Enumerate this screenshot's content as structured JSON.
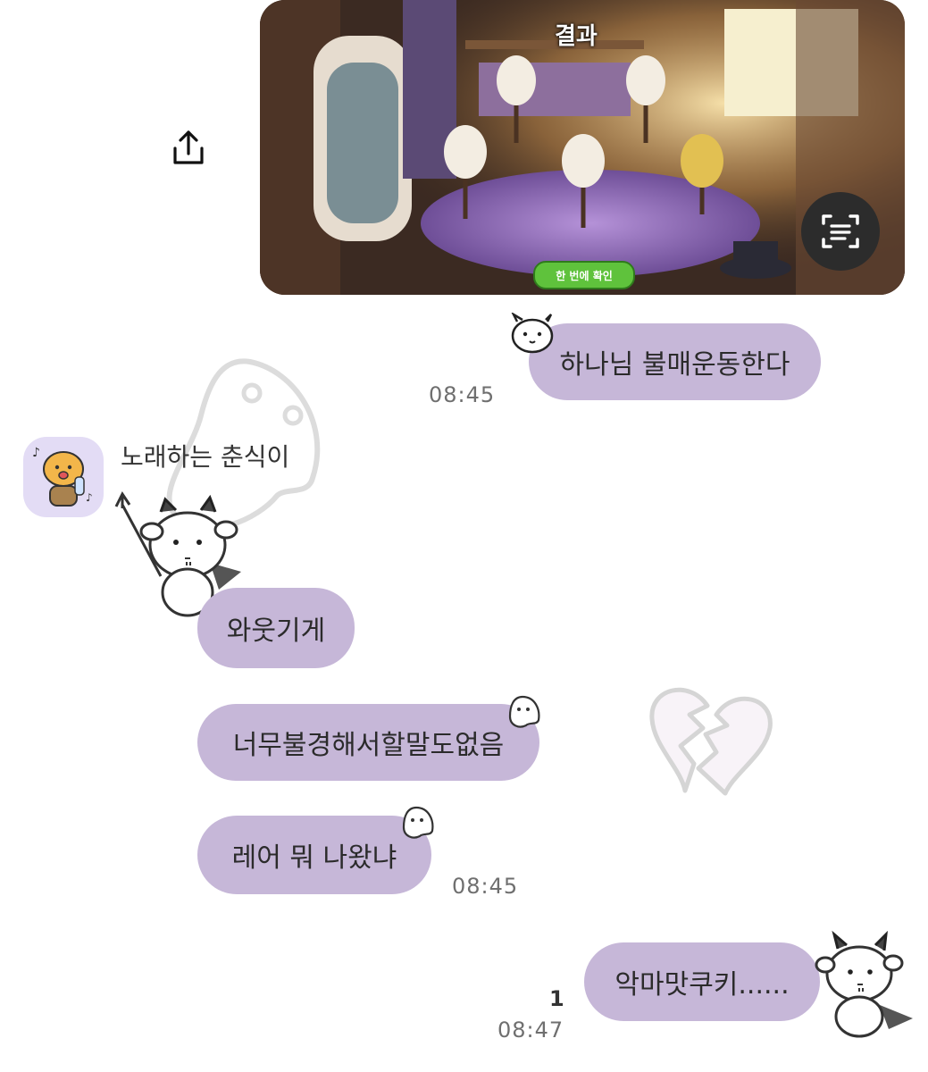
{
  "shared_image": {
    "title": "결과",
    "button_label": "한 번에 확인"
  },
  "messages_sent_1": {
    "text": "하나님 불매운동한다",
    "time": "08:45"
  },
  "received_group": {
    "sender_name": "노래하는 춘식이",
    "messages": [
      {
        "text": "와웃기게"
      },
      {
        "text": "너무불경해서할말도없음"
      },
      {
        "text": "레어 뭐 나왔냐"
      }
    ],
    "time": "08:45"
  },
  "messages_sent_2": {
    "text": "악마맛쿠키......",
    "unread_count": "1",
    "time": "08:47"
  },
  "icons": {
    "share": "share-icon",
    "scan": "text-scan-icon"
  },
  "colors": {
    "bubble": "#c6b7d8",
    "background": "#ffffff",
    "timestamp": "#6f6f6f"
  }
}
